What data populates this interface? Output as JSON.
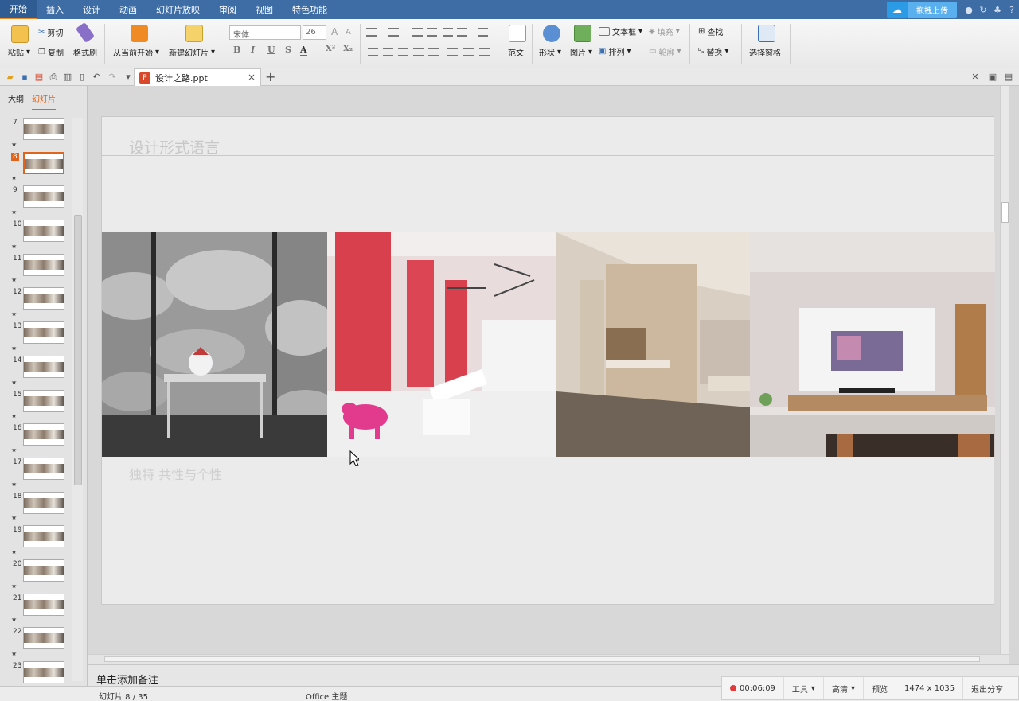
{
  "menubar": {
    "tabs": [
      "开始",
      "插入",
      "设计",
      "动画",
      "幻灯片放映",
      "审阅",
      "视图",
      "特色功能"
    ],
    "active_tab": "开始",
    "upload_label": "拖拽上传"
  },
  "ribbon": {
    "paste": "粘贴",
    "cut": "剪切",
    "copy": "复制",
    "format_painter": "格式刷",
    "start_from_current": "从当前开始",
    "new_slide": "新建幻灯片",
    "font_name": "宋体",
    "font_size": "26",
    "template": "范文",
    "shape": "形状",
    "picture": "图片",
    "textbox": "文本框",
    "fill": "填充",
    "arrange": "排列",
    "outline": "轮廓",
    "find": "查找",
    "replace": "替换",
    "selection_pane": "选择窗格"
  },
  "document": {
    "tab_name": "设计之路.ppt"
  },
  "left_panel": {
    "tabs": [
      "大纲",
      "幻灯片"
    ],
    "active_tab": "幻灯片",
    "slide_numbers": [
      "7",
      "8",
      "9",
      "10",
      "11",
      "12",
      "13",
      "14",
      "15",
      "16",
      "17",
      "18",
      "19",
      "20",
      "21",
      "22",
      "23"
    ],
    "selected_slide": "8"
  },
  "slide": {
    "title": "设计形式语言",
    "subtitle": "独特 共性与个性",
    "photos": [
      "cloud-wallpaper-console",
      "pink-red-cafe",
      "wood-cabinet-corridor",
      "living-room-tv-wall"
    ]
  },
  "notes": {
    "placeholder": "单击添加备注"
  },
  "statusbar": {
    "slide_info": "幻灯片 8 / 35",
    "theme": "Office 主题"
  },
  "recorder": {
    "time": "00:06:09",
    "tools": "工具",
    "quality": "高清",
    "preview": "预览",
    "resolution": "1474 x 1035",
    "exit_share": "退出分享"
  },
  "colors": {
    "menubar_bg": "#3e6da6",
    "accent_orange": "#e0641e",
    "upload_blue": "#2b9be6"
  }
}
